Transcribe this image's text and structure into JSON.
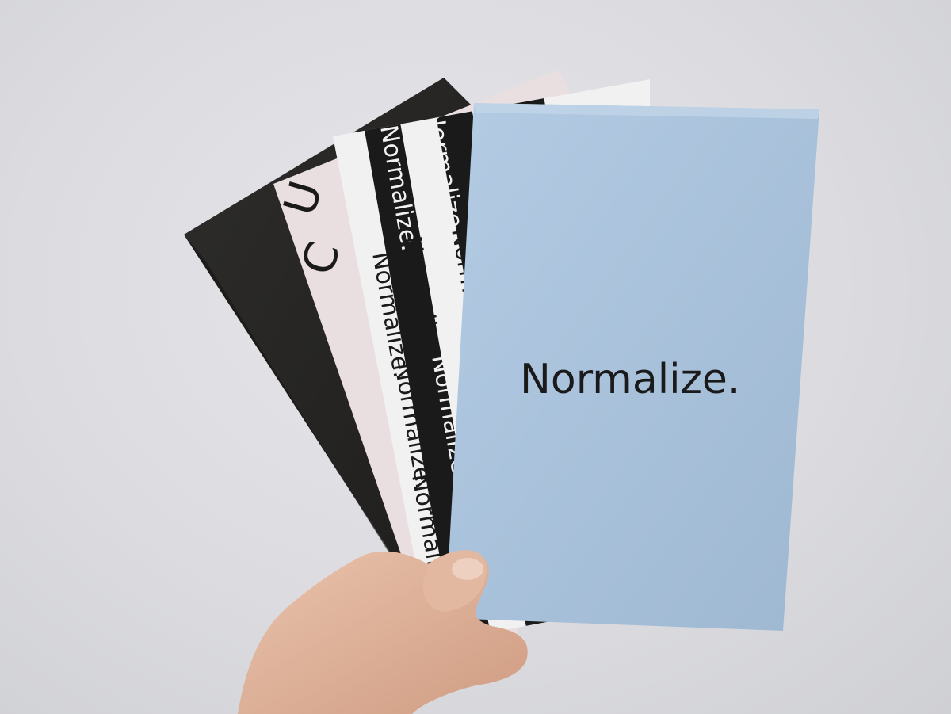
{
  "scene": {
    "colors": {
      "background": "#dcdce0",
      "black_booklet": "#2a2927",
      "pink_booklet": "#eadfe0",
      "striped_booklet_dark": "#1a1a1a",
      "striped_booklet_light": "#f1f1f1",
      "blue_booklet": "#a9c1da",
      "skin": "#e0b39a"
    },
    "blue_booklet": {
      "title": "Normalize."
    },
    "striped_booklet": {
      "repeated_word": "Normalize."
    },
    "pink_booklet": {
      "partial_letters": "U",
      "partial_letters_2": "C"
    }
  }
}
